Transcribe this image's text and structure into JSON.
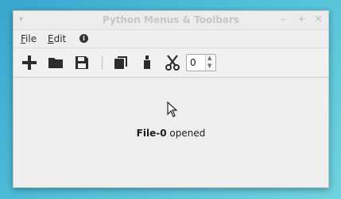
{
  "window": {
    "title": "Python Menus & Toolbars",
    "menu_arrow": "▾",
    "minimize": "–",
    "maximize": "+",
    "close": "✕"
  },
  "menubar": {
    "items": [
      {
        "label": "File",
        "mnemonic": "F"
      },
      {
        "label": "Edit",
        "mnemonic": "E"
      }
    ],
    "info_icon": "i"
  },
  "toolbar": {
    "tools": [
      "plus-icon",
      "folder-icon",
      "save-icon",
      "copy-icon",
      "bottle-icon",
      "scissors-icon"
    ],
    "spin_value": "0"
  },
  "content": {
    "status_bold": "File-0",
    "status_rest": " opened"
  }
}
